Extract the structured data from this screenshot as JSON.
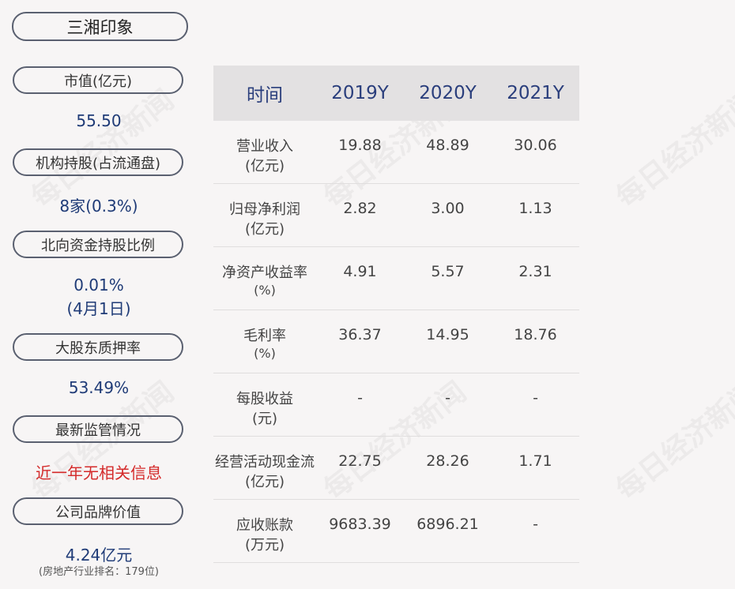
{
  "company": "三湘印象",
  "watermark": "每日经济新闻",
  "left": [
    {
      "label": "市值(亿元)",
      "value": "55.50"
    },
    {
      "label": "机构持股(占流通盘)",
      "value": "8家(0.3%)"
    },
    {
      "label": "北向资金持股比例",
      "value": "0.01%",
      "value2": "(4月1日)"
    },
    {
      "label": "大股东质押率",
      "value": "53.49%"
    },
    {
      "label": "最新监管情况",
      "value": "近一年无相关信息"
    },
    {
      "label": "公司品牌价值",
      "value": "4.24亿元",
      "note": "(房地产行业排名：179位)"
    }
  ],
  "table": {
    "headers": [
      "时间",
      "2019Y",
      "2020Y",
      "2021Y"
    ],
    "rows": [
      {
        "label1": "营业收入",
        "label2": "(亿元)",
        "v": [
          "19.88",
          "48.89",
          "30.06"
        ]
      },
      {
        "label1": "归母净利润",
        "label2": "(亿元)",
        "v": [
          "2.82",
          "3.00",
          "1.13"
        ]
      },
      {
        "label1": "净资产收益率",
        "label2": "(%)",
        "v": [
          "4.91",
          "5.57",
          "2.31"
        ]
      },
      {
        "label1": "毛利率",
        "label2": "(%)",
        "v": [
          "36.37",
          "14.95",
          "18.76"
        ]
      },
      {
        "label1": "每股收益",
        "label2": "(元)",
        "v": [
          "-",
          "-",
          "-"
        ]
      },
      {
        "label1": "经营活动现金流",
        "label2": "(亿元)",
        "v": [
          "22.75",
          "28.26",
          "1.71"
        ]
      },
      {
        "label1": "应收账款",
        "label2": "(万元)",
        "v": [
          "9683.39",
          "6896.21",
          "-"
        ]
      }
    ]
  }
}
